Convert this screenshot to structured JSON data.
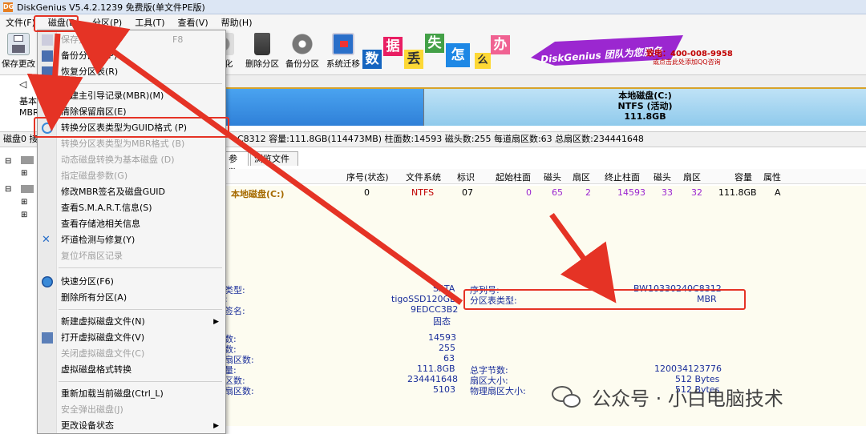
{
  "window": {
    "title": "DiskGenius V5.4.2.1239 免费版(单文件PE版)",
    "app_icon": "DG"
  },
  "menubar": [
    "文件(F)",
    "磁盘(D)",
    "分区(P)",
    "工具(T)",
    "查看(V)",
    "帮助(H)"
  ],
  "toolbar": [
    {
      "label": "保存更改",
      "icon": "save-icon"
    },
    {
      "label": "化",
      "icon": "format-icon"
    },
    {
      "label": "删除分区",
      "icon": "trash-icon"
    },
    {
      "label": "备份分区",
      "icon": "backup-icon"
    },
    {
      "label": "系统迁移",
      "icon": "migrate-icon"
    }
  ],
  "banner": {
    "chars": [
      "数",
      "据",
      "丢",
      "失",
      "怎",
      "么",
      "办"
    ],
    "service": "DiskGenius 团队为您服务",
    "phone": "致电：400-008-9958",
    "qq": "或点击此处添加QQ咨询"
  },
  "nav": {
    "left_label1": "基本",
    "left_label2": "MBR"
  },
  "partition_box": {
    "name": "本地磁盘(C:)",
    "fs": "NTFS (活动)",
    "size": "111.8GB"
  },
  "info_line": "磁盘0 接口:SATA 型号:tigoSSD120GB 序列号:BW10330240C8312 容量:111.8GB(114473MB) 柱面数:14593 磁头数:255 每道扇区数:63 总扇区数:234441648",
  "info_line_visible": "磁盘0 接",
  "info_line_right": "C8312  容量:111.8GB(114473MB)  柱面数:14593  磁头数:255  每道扇区数:63  总扇区数:234441648",
  "tabs": [
    "参数",
    "浏览文件"
  ],
  "table": {
    "headers": [
      "序号(状态)",
      "文件系统",
      "标识",
      "起始柱面",
      "磁头",
      "扇区",
      "终止柱面",
      "磁头",
      "扇区",
      "容量",
      "属性"
    ],
    "row": {
      "name": "本地磁盘(C:)",
      "cells": [
        "0",
        "NTFS",
        "07",
        "0",
        "65",
        "2",
        "14593",
        "33",
        "32",
        "111.8GB",
        "A"
      ]
    }
  },
  "details": {
    "left_labels": [
      "类型:",
      ":",
      "签名:"
    ],
    "left_values": [
      "SATA",
      "tigoSSD120GB",
      "9EDCC3B2",
      "固态"
    ],
    "serial_label": "序列号:",
    "serial_value": "BW10330240C8312",
    "pt_label": "分区表类型:",
    "pt_value": "MBR",
    "geom_labels": [
      "数:",
      "数:",
      "扇区数:",
      "量:",
      "区数:",
      "扇区数:"
    ],
    "geom_values": [
      "14593",
      "255",
      "63",
      "111.8GB",
      "234441648",
      "5103"
    ],
    "right_labels": [
      "总字节数:",
      "扇区大小:",
      "物理扇区大小:"
    ],
    "right_values": [
      "120034123776",
      "512 Bytes",
      "512 Bytes"
    ]
  },
  "context_menu": [
    {
      "label": "保存更改(S)",
      "shortcut": "F8",
      "disabled": true,
      "icon": "save-icon"
    },
    {
      "label": "备份分区表(P)",
      "disabled": false,
      "icon": "table-icon"
    },
    {
      "label": "恢复分区表(R)",
      "disabled": false,
      "icon": "table-icon"
    },
    {
      "sep": true
    },
    {
      "label": "重建主引导记录(MBR)(M)",
      "disabled": false,
      "icon": "edit-icon"
    },
    {
      "label": "清除保留扇区(E)",
      "disabled": false,
      "icon": ""
    },
    {
      "label": "转换分区表类型为GUID格式 (P)",
      "disabled": false,
      "icon": "convert-icon"
    },
    {
      "label": "转换分区表类型为MBR格式 (B)",
      "disabled": true,
      "icon": ""
    },
    {
      "label": "动态磁盘转换为基本磁盘 (D)",
      "disabled": true,
      "icon": ""
    },
    {
      "label": "指定磁盘参数(G)",
      "disabled": true,
      "icon": ""
    },
    {
      "label": "修改MBR签名及磁盘GUID",
      "disabled": false,
      "icon": ""
    },
    {
      "label": "查看S.M.A.R.T.信息(S)",
      "disabled": false,
      "icon": ""
    },
    {
      "label": "查看存储池相关信息",
      "disabled": false,
      "icon": ""
    },
    {
      "label": "坏道检测与修复(Y)",
      "disabled": false,
      "icon": "tools-icon"
    },
    {
      "label": "复位坏扇区记录",
      "disabled": true,
      "icon": ""
    },
    {
      "sep": true
    },
    {
      "label": "快速分区(F6)",
      "disabled": false,
      "icon": "quick-partition-icon"
    },
    {
      "label": "删除所有分区(A)",
      "disabled": false,
      "icon": ""
    },
    {
      "sep": true
    },
    {
      "label": "新建虚拟磁盘文件(N)",
      "disabled": false,
      "icon": "",
      "submenu": true
    },
    {
      "label": "打开虚拟磁盘文件(V)",
      "disabled": false,
      "icon": "open-icon"
    },
    {
      "label": "关闭虚拟磁盘文件(C)",
      "disabled": true,
      "icon": ""
    },
    {
      "label": "虚拟磁盘格式转换",
      "disabled": false,
      "icon": ""
    },
    {
      "sep": true
    },
    {
      "label": "重新加载当前磁盘(Ctrl_L)",
      "disabled": false,
      "icon": ""
    },
    {
      "label": "安全弹出磁盘(J)",
      "disabled": true,
      "icon": ""
    },
    {
      "label": "更改设备状态",
      "disabled": false,
      "icon": "",
      "submenu": true
    }
  ],
  "watermark": "公众号 · 小白电脑技术",
  "colors": {
    "highlight": "#e53325",
    "partition_text": "#1a2e9a",
    "ntfs": "#c00000",
    "brand_purple": "#9b27d0"
  }
}
